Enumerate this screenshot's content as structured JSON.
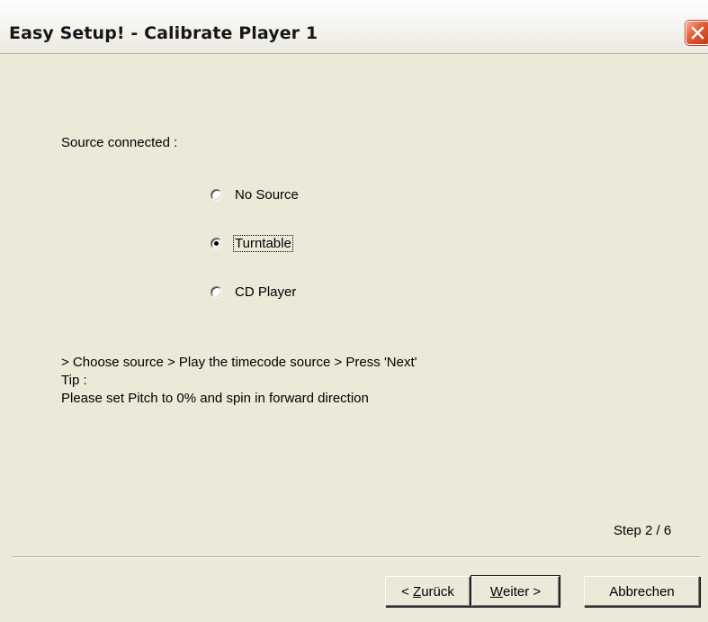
{
  "window": {
    "title": "Easy Setup! - Calibrate Player 1"
  },
  "form": {
    "source_label": "Source connected :",
    "options": [
      {
        "label": "No Source",
        "selected": false
      },
      {
        "label": "Turntable",
        "selected": true
      },
      {
        "label": "CD Player",
        "selected": false
      }
    ]
  },
  "instructions": {
    "line1": "> Choose source > Play the timecode source > Press 'Next'",
    "line2": "Tip :",
    "line3": "Please set Pitch to 0% and spin in forward direction"
  },
  "step": {
    "text": "Step 2 / 6"
  },
  "buttons": {
    "back_prefix": "< ",
    "back_mnemonic": "Z",
    "back_rest": "urück",
    "next_mnemonic": "W",
    "next_rest": "eiter >",
    "cancel": "Abbrechen"
  },
  "icons": {
    "close": "close-icon"
  },
  "colors": {
    "dialog_bg": "#ece9d8",
    "close_button": "#e25a33"
  }
}
